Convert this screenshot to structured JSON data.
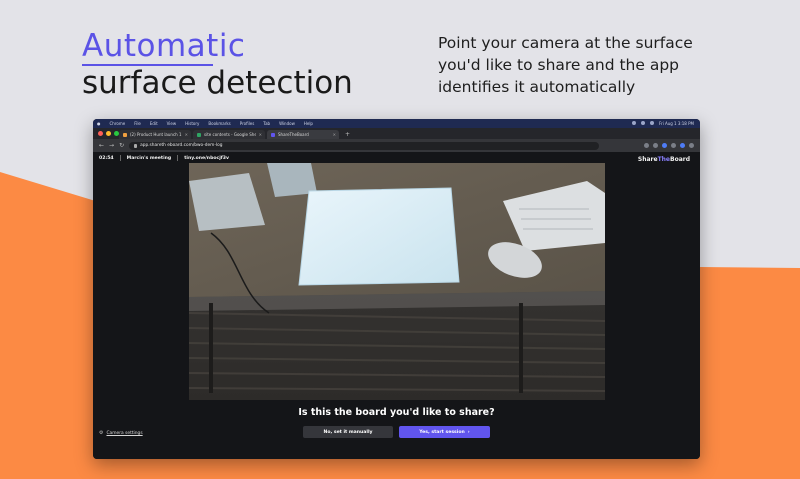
{
  "colors": {
    "accent": "#5b53e6",
    "orange": "#fc8a44",
    "gray_bg": "#e3e3e8",
    "primary_button": "#6155ee"
  },
  "headline": {
    "line1": "Automatic",
    "line2": "surface detection"
  },
  "tagline": "Point your camera at the surface you'd like to share and the app identifies it automatically",
  "os_menubar": {
    "items": [
      "Chrome",
      "File",
      "Edit",
      "View",
      "History",
      "Bookmarks",
      "Profiles",
      "Tab",
      "Window",
      "Help"
    ],
    "clock": "Fri Aug 1 3:18 PM"
  },
  "browser": {
    "tabs": [
      {
        "title": "(2) Product Hunt launch 1",
        "icon": "orange-favicon"
      },
      {
        "title": "site contents - Google Sheets",
        "icon": "sheets-favicon"
      },
      {
        "title": "ShareTheBoard",
        "icon": "stb-favicon",
        "active": true
      }
    ],
    "new_tab": "+",
    "url": "app.shareth eboard.com/bwo-dem-log",
    "nav": {
      "back": "←",
      "forward": "→",
      "reload": "↻"
    }
  },
  "app": {
    "timer": "02:54",
    "meeting_name": "Marcin's meeting",
    "short_link": "tiny.one/nbocjf3v",
    "brand_prefix": "Share",
    "brand_mid": "The",
    "brand_suffix": "Board",
    "question": "Is this the board you'd like to share?",
    "secondary_button": "No, set it manually",
    "primary_button": "Yes, start session",
    "primary_button_icon": "chevron-right-icon",
    "camera_settings": "Camera settings",
    "camera_settings_icon": "gear-icon"
  }
}
